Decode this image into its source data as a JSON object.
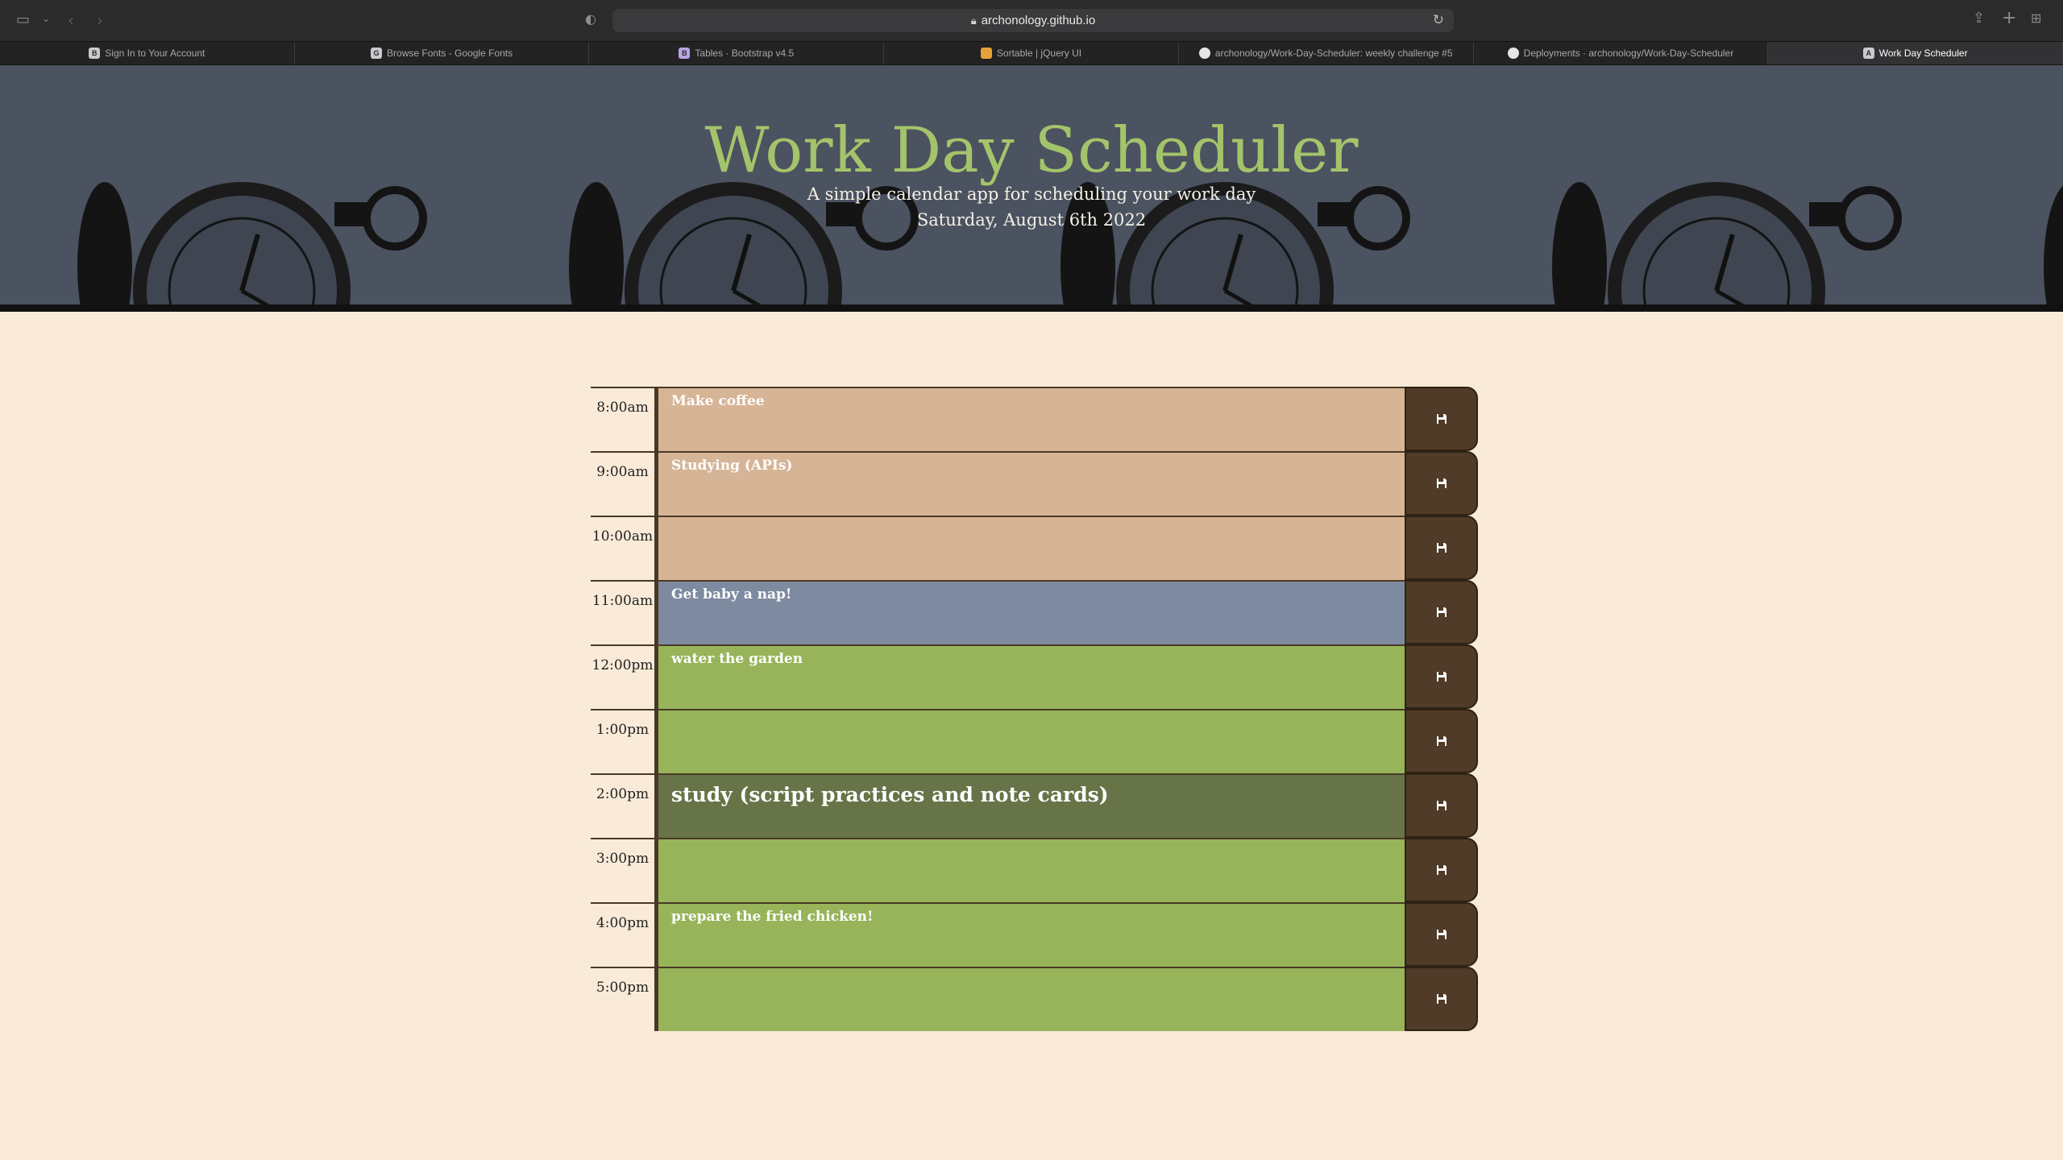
{
  "browser": {
    "url": "archonology.github.io",
    "tabs": [
      {
        "label": "Sign In to Your Account",
        "favicon": "B",
        "favicon_color": "#c9c9cf"
      },
      {
        "label": "Browse Fonts - Google Fonts",
        "favicon": "G",
        "favicon_color": "#c9c9cf"
      },
      {
        "label": "Tables · Bootstrap v4.5",
        "favicon": "B",
        "favicon_color": "#b9a3e6"
      },
      {
        "label": "Sortable | jQuery UI",
        "favicon": "",
        "favicon_color": "#e8a23a"
      },
      {
        "label": "archonology/Work-Day-Scheduler: weekly challenge #5",
        "favicon": "",
        "favicon_color": "#e6e6e6"
      },
      {
        "label": "Deployments · archonology/Work-Day-Scheduler",
        "favicon": "",
        "favicon_color": "#e6e6e6"
      },
      {
        "label": "Work Day Scheduler",
        "favicon": "A",
        "favicon_color": "#c9c9cf",
        "active": true
      }
    ]
  },
  "header": {
    "title": "Work Day Scheduler",
    "lead": "A simple calendar app for scheduling your work day",
    "date": "Saturday, August 6th 2022"
  },
  "colors": {
    "past": "#d6b496",
    "present": "#7d8a9f",
    "future": "#97b45a",
    "title": "#a3c46a",
    "save_button": "#4f3b27"
  },
  "schedule": [
    {
      "hour": "8:00am",
      "text": "Make coffee",
      "state": "past"
    },
    {
      "hour": "9:00am",
      "text": "Studying (APIs)",
      "state": "past"
    },
    {
      "hour": "10:00am",
      "text": "",
      "state": "past"
    },
    {
      "hour": "11:00am",
      "text": "Get baby a nap!",
      "state": "present"
    },
    {
      "hour": "12:00pm",
      "text": "water the garden",
      "state": "future"
    },
    {
      "hour": "1:00pm",
      "text": "",
      "state": "future"
    },
    {
      "hour": "2:00pm",
      "text": "study (script practices and note cards)",
      "state": "future-focus"
    },
    {
      "hour": "3:00pm",
      "text": "",
      "state": "future"
    },
    {
      "hour": "4:00pm",
      "text": "prepare the fried chicken!",
      "state": "future"
    },
    {
      "hour": "5:00pm",
      "text": "",
      "state": "future"
    }
  ],
  "save_icon": "floppy-disk-icon"
}
